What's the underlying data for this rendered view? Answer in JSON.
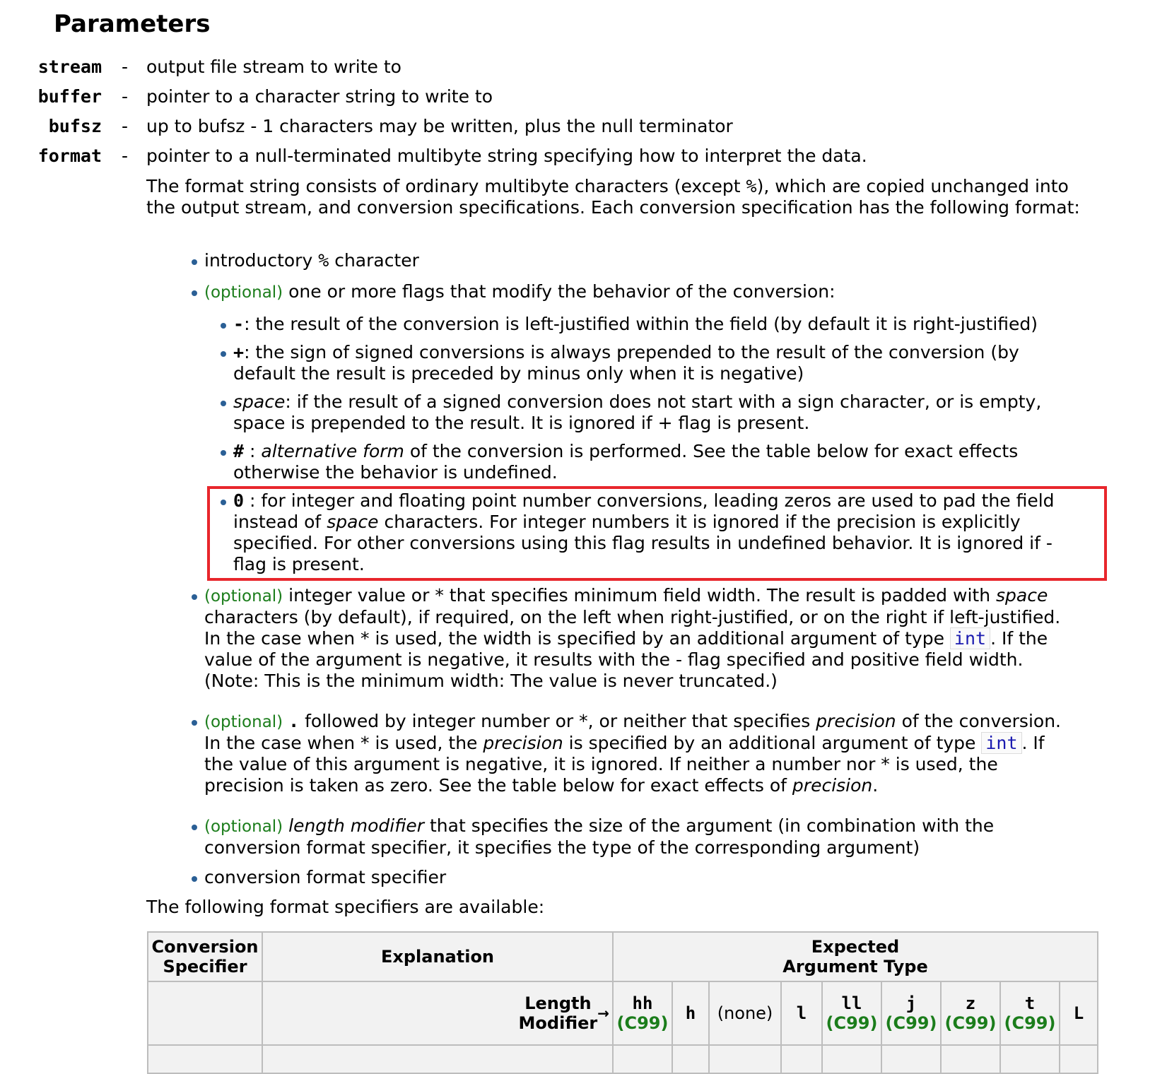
{
  "heading": "Parameters",
  "params": [
    {
      "name": "stream",
      "dash": "-",
      "desc": "output file stream to write to"
    },
    {
      "name": "buffer",
      "dash": "-",
      "desc": "pointer to a character string to write to"
    },
    {
      "name": "bufsz",
      "dash": "-",
      "desc": "up to bufsz - 1 characters may be written, plus the null terminator"
    },
    {
      "name": "format",
      "dash": "-",
      "desc": "pointer to a null-terminated multibyte string specifying how to interpret the data."
    }
  ],
  "format_intro": {
    "pre": "The format string consists of ordinary multibyte characters (except ",
    "percent": "%",
    "post": "), which are copied unchanged into the output stream, and conversion specifications. Each conversion specification has the following format:"
  },
  "optional_label": "(optional)",
  "items": {
    "introductory": {
      "pre": "introductory ",
      "code": "%",
      "post": " character"
    },
    "flags_intro": "one or more flags that modify the behavior of the conversion:",
    "flag_minus": {
      "sym": "-",
      "text": ": the result of the conversion is left-justified within the field (by default it is right-justified)"
    },
    "flag_plus": {
      "sym": "+",
      "line1": ": the sign of signed conversions is always prepended to the result of the conversion (by",
      "line2": "default the result is preceded by minus only when it is negative)"
    },
    "flag_space": {
      "sym": "space",
      "line1": ": if the result of a signed conversion does not start with a sign character, or is empty,",
      "line2": "space is prepended to the result. It is ignored if + flag is present."
    },
    "flag_hash": {
      "sym": "#",
      "mid": " : ",
      "em": "alternative form",
      "line1": " of the conversion is performed. See the table below for exact effects",
      "line2": "otherwise the behavior is undefined."
    },
    "flag_zero": {
      "sym": "0",
      "line1": " : for integer and floating point number conversions, leading zeros are used to pad the field",
      "line2_pre": "instead of ",
      "line2_em": "space",
      "line2_post": " characters. For integer numbers it is ignored if the precision is explicitly",
      "line3": "specified. For other conversions using this flag results in undefined behavior. It is ignored if -",
      "line4": "flag is present."
    },
    "width": {
      "line1_pre": "integer value or * that specifies minimum field width. The result is padded with ",
      "line1_em": "space",
      "line2": "characters (by default), if required, on the left when right-justified, or on the right if left-justified.",
      "line3_pre": "In the case when * is used, the width is specified by an additional argument of type ",
      "line3_code": "int",
      "line3_post": ". If the",
      "line4": "value of the argument is negative, it results with the - flag specified and positive field width.",
      "line5": "(Note: This is the minimum width: The value is never truncated.)"
    },
    "precision": {
      "line1_pre": " followed by integer number or *, or neither that specifies ",
      "dot": ".",
      "line1_em": "precision",
      "line1_post": " of the conversion.",
      "line2_pre": "In the case when * is used, the ",
      "line2_em": "precision",
      "line2_mid": " is specified by an additional argument of type ",
      "line2_code": "int",
      "line2_post": ". If",
      "line3": "the value of this argument is negative, it is ignored. If neither a number nor * is used, the",
      "line4_pre": "precision is taken as zero. See the table below for exact effects of ",
      "line4_em": "precision",
      "line4_post": "."
    },
    "length": {
      "em": "length modifier",
      "line1": " that specifies the size of the argument (in combination with the",
      "line2": "conversion format specifier, it specifies the type of the corresponding argument)"
    },
    "conversion": "conversion format specifier"
  },
  "following": "The following format specifiers are available:",
  "table": {
    "h_conv1": "Conversion",
    "h_conv2": "Specifier",
    "h_expl": "Explanation",
    "h_expected1": "Expected",
    "h_expected2": "Argument Type",
    "length_modifier1": "Length",
    "length_modifier2": "Modifier",
    "arrow": "→",
    "c99": "(C99)",
    "mods": [
      "hh",
      "h",
      "(none)",
      "l",
      "ll",
      "j",
      "z",
      "t",
      "L"
    ]
  }
}
